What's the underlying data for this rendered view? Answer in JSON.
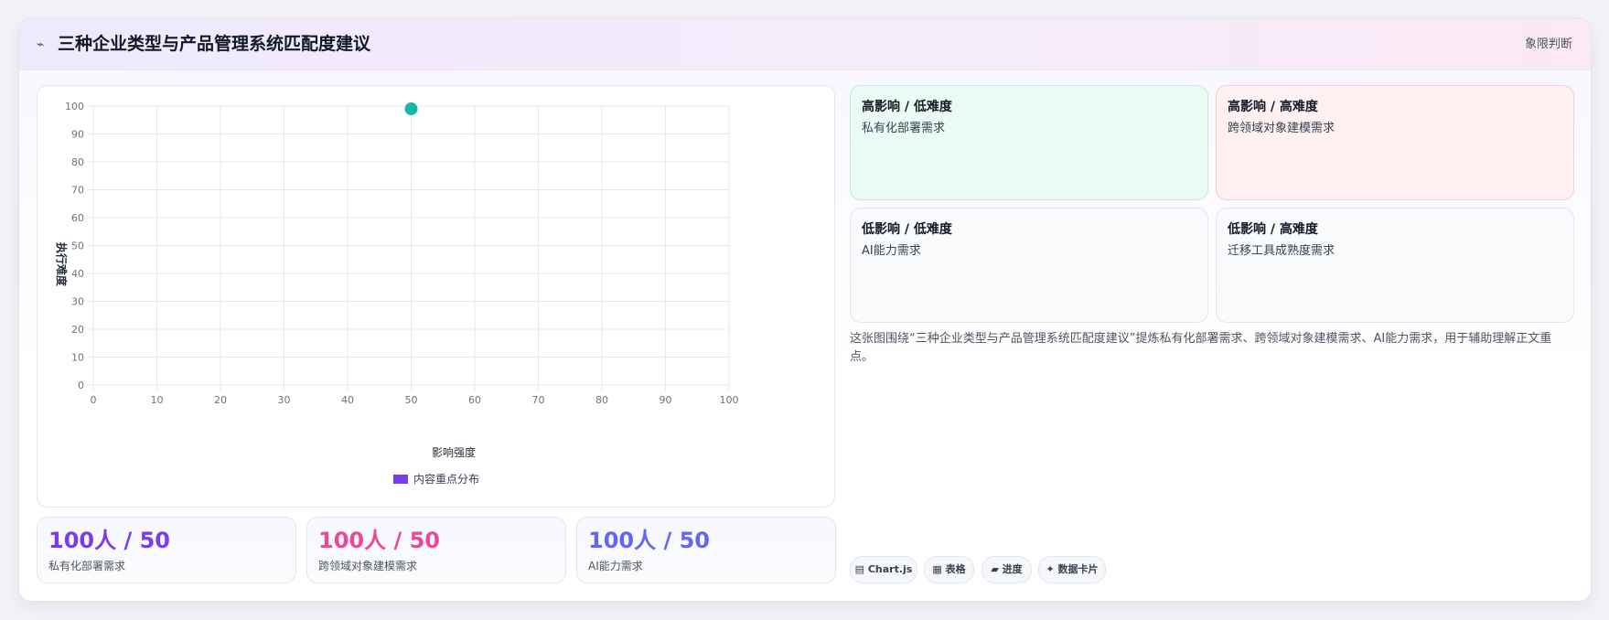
{
  "header": {
    "icon": "spark-icon",
    "title": "三种企业类型与产品管理系统匹配度建议",
    "tag": "象限判断"
  },
  "chart_data": {
    "type": "scatter",
    "xlabel": "影响强度",
    "ylabel": "执行难度",
    "xlim": [
      0,
      100
    ],
    "ylim": [
      0,
      100
    ],
    "x_ticks": [
      "0",
      "10",
      "20",
      "30",
      "40",
      "50",
      "60",
      "70",
      "80",
      "90",
      "100"
    ],
    "y_ticks": [
      "0",
      "10",
      "20",
      "30",
      "40",
      "50",
      "60",
      "70",
      "80",
      "90",
      "100"
    ],
    "grid": true,
    "legend_position": "bottom",
    "series": [
      {
        "name": "内容重点分布",
        "legend_color": "#7c3aed",
        "point_color": "#14b8a6",
        "points": [
          {
            "x": 50,
            "y": 99
          }
        ]
      }
    ]
  },
  "stats": [
    {
      "value": "100人 / 50",
      "label": "私有化部署需求",
      "color": "#7c3aed"
    },
    {
      "value": "100人 / 50",
      "label": "跨领域对象建模需求",
      "color": "#ec4899"
    },
    {
      "value": "100人 / 50",
      "label": "AI能力需求",
      "color": "#6366f1"
    }
  ],
  "quadrants": [
    {
      "title": "高影响 / 低难度",
      "item": "私有化部署需求",
      "bg": "#ebfbf3",
      "border": "#bfeed5"
    },
    {
      "title": "高影响 / 高难度",
      "item": "跨领域对象建模需求",
      "bg": "#fff0f1",
      "border": "#f7cdd3"
    },
    {
      "title": "低影响 / 低难度",
      "item": "AI能力需求",
      "bg": "#f8fafc",
      "border": "#e2e6ef"
    },
    {
      "title": "低影响 / 高难度",
      "item": "迁移工具成熟度需求",
      "bg": "#f8fafc",
      "border": "#e2e6ef"
    }
  ],
  "description": "这张图围绕“三种企业类型与产品管理系统匹配度建议”提炼私有化部署需求、跨领域对象建模需求、AI能力需求，用于辅助理解正文重点。",
  "chips": [
    {
      "label": "▤ Chart.js",
      "icon": "chart-icon"
    },
    {
      "label": "▦ 表格",
      "icon": "table-icon"
    },
    {
      "label": "▰ 进度",
      "icon": "progress-icon"
    },
    {
      "label": "✦ 数据卡片",
      "icon": "card-icon"
    }
  ]
}
